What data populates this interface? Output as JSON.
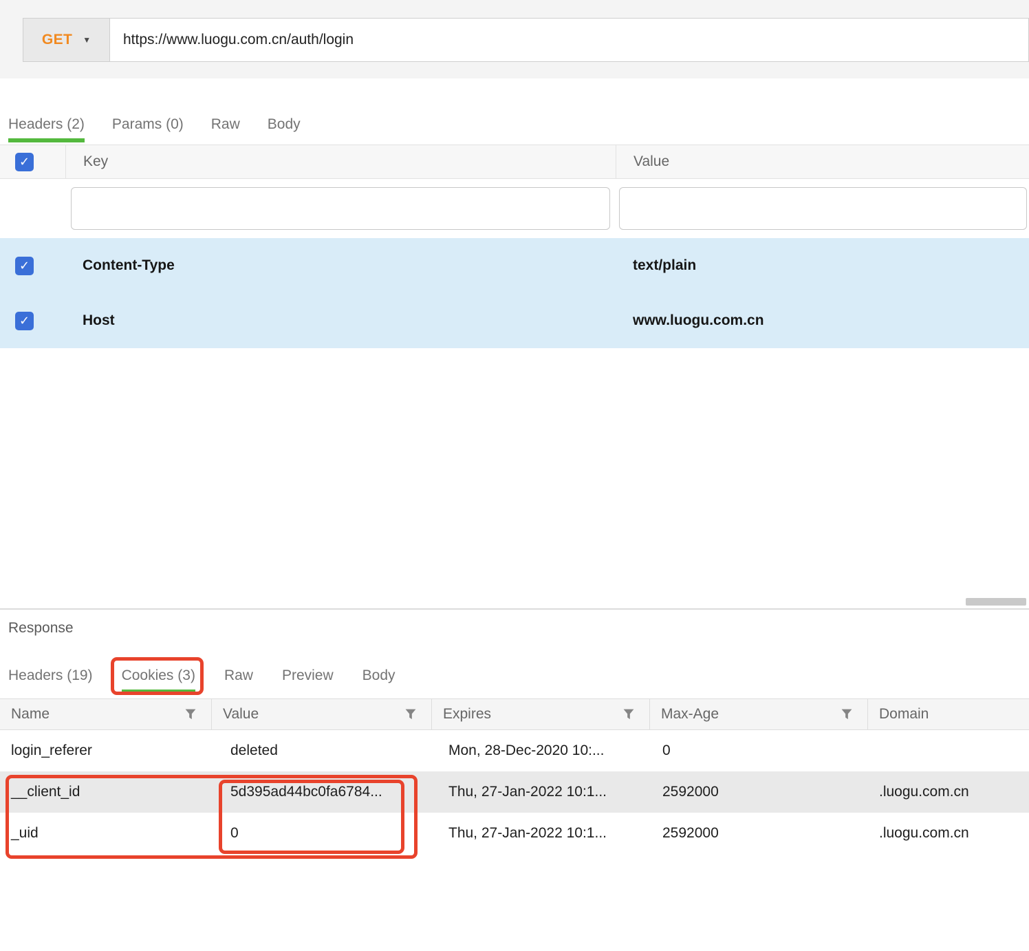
{
  "icons": {
    "checkmark": "✓",
    "caret_down": "▼"
  },
  "colors": {
    "method_orange": "#f18a21",
    "tab_active_green": "#54b93e",
    "checkbox_blue": "#3a6fd8",
    "header_row_highlight": "#d9ecf8",
    "annotation_red": "#e8432c"
  },
  "request": {
    "method": "GET",
    "url": "https://www.luogu.com.cn/auth/login",
    "tabs": [
      {
        "label": "Headers (2)",
        "active": true
      },
      {
        "label": "Params (0)",
        "active": false
      },
      {
        "label": "Raw",
        "active": false
      },
      {
        "label": "Body",
        "active": false
      }
    ],
    "headers_table": {
      "columns": {
        "key": "Key",
        "value": "Value"
      },
      "filters": {
        "key": "",
        "value": ""
      },
      "rows": [
        {
          "checked": true,
          "key": "Content-Type",
          "value": "text/plain"
        },
        {
          "checked": true,
          "key": "Host",
          "value": "www.luogu.com.cn"
        }
      ]
    }
  },
  "response": {
    "section_label": "Response",
    "tabs": [
      {
        "label": "Headers (19)",
        "active": false
      },
      {
        "label": "Cookies (3)",
        "active": true
      },
      {
        "label": "Raw",
        "active": false
      },
      {
        "label": "Preview",
        "active": false
      },
      {
        "label": "Body",
        "active": false
      }
    ],
    "cookies_table": {
      "columns": [
        "Name",
        "Value",
        "Expires",
        "Max-Age",
        "Domain"
      ],
      "rows": [
        {
          "name": "login_referer",
          "value": "deleted",
          "expires": "Mon, 28-Dec-2020 10:...",
          "max_age": "0",
          "domain": ""
        },
        {
          "name": "__client_id",
          "value": "5d395ad44bc0fa6784...",
          "expires": "Thu, 27-Jan-2022 10:1...",
          "max_age": "2592000",
          "domain": ".luogu.com.cn"
        },
        {
          "name": "_uid",
          "value": "0",
          "expires": "Thu, 27-Jan-2022 10:1...",
          "max_age": "2592000",
          "domain": ".luogu.com.cn"
        }
      ]
    }
  }
}
